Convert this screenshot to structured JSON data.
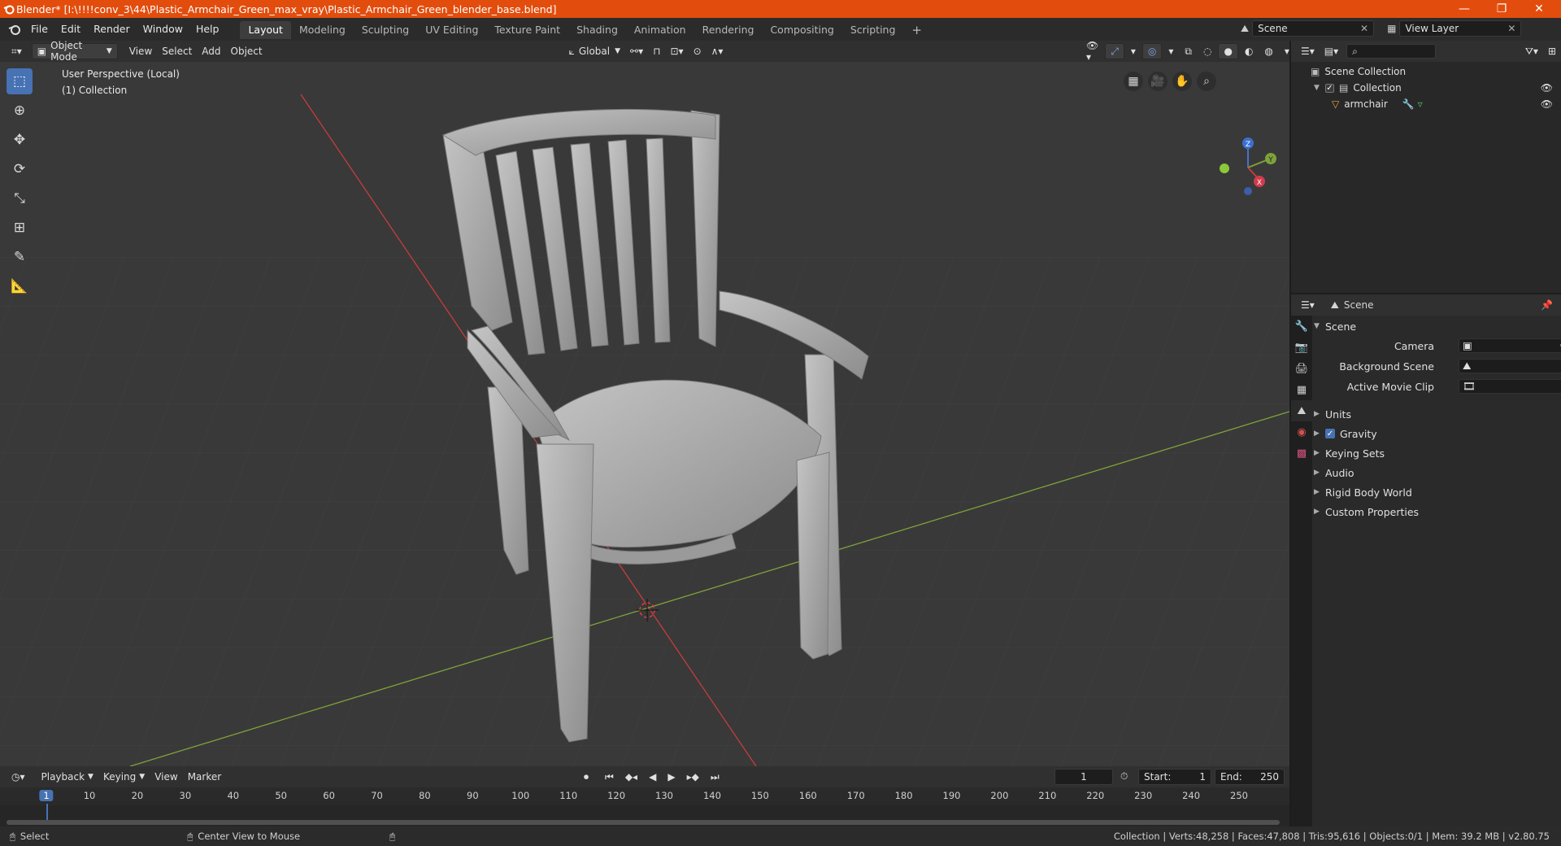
{
  "window": {
    "title": "Blender* [I:\\!!!!conv_3\\44\\Plastic_Armchair_Green_max_vray\\Plastic_Armchair_Green_blender_base.blend]",
    "minimize": "—",
    "maximize": "❐",
    "close": "✕"
  },
  "menus": [
    "File",
    "Edit",
    "Render",
    "Window",
    "Help"
  ],
  "workspaces": [
    "Layout",
    "Modeling",
    "Sculpting",
    "UV Editing",
    "Texture Paint",
    "Shading",
    "Animation",
    "Rendering",
    "Compositing",
    "Scripting"
  ],
  "workspace_add": "+",
  "scene_field": "Scene",
  "view_layer_field": "View Layer",
  "viewport_header": {
    "mode": "Object Mode",
    "view": "View",
    "select": "Select",
    "add": "Add",
    "object": "Object",
    "orientation": "Global"
  },
  "viewport": {
    "perspective": "User Perspective (Local)",
    "collection": "(1) Collection"
  },
  "gizmo": {
    "z": "Z",
    "y": "Y",
    "x": "X"
  },
  "outliner": {
    "root": "Scene Collection",
    "collection": "Collection",
    "object": "armchair"
  },
  "properties": {
    "header": "Scene",
    "panel": "Scene",
    "camera_label": "Camera",
    "background_label": "Background Scene",
    "movie_clip_label": "Active Movie Clip",
    "sections": [
      "Units",
      "Gravity",
      "Keying Sets",
      "Audio",
      "Rigid Body World",
      "Custom Properties"
    ]
  },
  "timeline": {
    "playback": "Playback",
    "keying": "Keying",
    "view": "View",
    "marker": "Marker",
    "current_frame": "1",
    "start_label": "Start:",
    "start": "1",
    "end_label": "End:",
    "end": "250",
    "ticks": [
      "1",
      "10",
      "20",
      "30",
      "40",
      "50",
      "60",
      "70",
      "80",
      "90",
      "100",
      "110",
      "120",
      "130",
      "140",
      "150",
      "160",
      "170",
      "180",
      "190",
      "200",
      "210",
      "220",
      "230",
      "240",
      "250"
    ]
  },
  "status": {
    "select": "Select",
    "center_view": "Center View to Mouse",
    "stats": "Collection | Verts:48,258 | Faces:47,808 | Tris:95,616 | Objects:0/1 | Mem: 39.2 MB | v2.80.75"
  },
  "colors": {
    "accent": "#4772b3",
    "titlebar": "#e24d0e",
    "x_axis": "#c83c3c",
    "y_axis": "#7ea23a"
  }
}
